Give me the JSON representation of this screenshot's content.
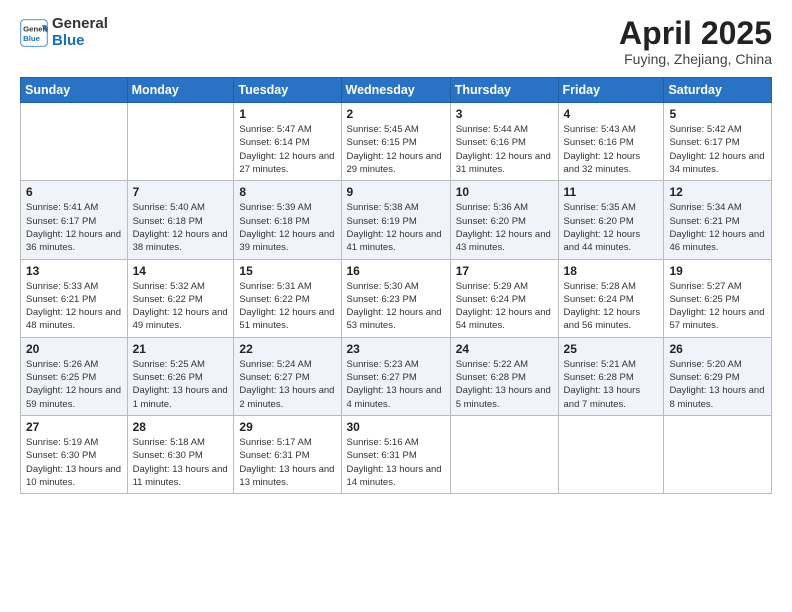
{
  "header": {
    "logo_general": "General",
    "logo_blue": "Blue",
    "month_year": "April 2025",
    "location": "Fuying, Zhejiang, China"
  },
  "weekdays": [
    "Sunday",
    "Monday",
    "Tuesday",
    "Wednesday",
    "Thursday",
    "Friday",
    "Saturday"
  ],
  "weeks": [
    [
      {
        "day": "",
        "info": ""
      },
      {
        "day": "",
        "info": ""
      },
      {
        "day": "1",
        "info": "Sunrise: 5:47 AM\nSunset: 6:14 PM\nDaylight: 12 hours and 27 minutes."
      },
      {
        "day": "2",
        "info": "Sunrise: 5:45 AM\nSunset: 6:15 PM\nDaylight: 12 hours and 29 minutes."
      },
      {
        "day": "3",
        "info": "Sunrise: 5:44 AM\nSunset: 6:16 PM\nDaylight: 12 hours and 31 minutes."
      },
      {
        "day": "4",
        "info": "Sunrise: 5:43 AM\nSunset: 6:16 PM\nDaylight: 12 hours and 32 minutes."
      },
      {
        "day": "5",
        "info": "Sunrise: 5:42 AM\nSunset: 6:17 PM\nDaylight: 12 hours and 34 minutes."
      }
    ],
    [
      {
        "day": "6",
        "info": "Sunrise: 5:41 AM\nSunset: 6:17 PM\nDaylight: 12 hours and 36 minutes."
      },
      {
        "day": "7",
        "info": "Sunrise: 5:40 AM\nSunset: 6:18 PM\nDaylight: 12 hours and 38 minutes."
      },
      {
        "day": "8",
        "info": "Sunrise: 5:39 AM\nSunset: 6:18 PM\nDaylight: 12 hours and 39 minutes."
      },
      {
        "day": "9",
        "info": "Sunrise: 5:38 AM\nSunset: 6:19 PM\nDaylight: 12 hours and 41 minutes."
      },
      {
        "day": "10",
        "info": "Sunrise: 5:36 AM\nSunset: 6:20 PM\nDaylight: 12 hours and 43 minutes."
      },
      {
        "day": "11",
        "info": "Sunrise: 5:35 AM\nSunset: 6:20 PM\nDaylight: 12 hours and 44 minutes."
      },
      {
        "day": "12",
        "info": "Sunrise: 5:34 AM\nSunset: 6:21 PM\nDaylight: 12 hours and 46 minutes."
      }
    ],
    [
      {
        "day": "13",
        "info": "Sunrise: 5:33 AM\nSunset: 6:21 PM\nDaylight: 12 hours and 48 minutes."
      },
      {
        "day": "14",
        "info": "Sunrise: 5:32 AM\nSunset: 6:22 PM\nDaylight: 12 hours and 49 minutes."
      },
      {
        "day": "15",
        "info": "Sunrise: 5:31 AM\nSunset: 6:22 PM\nDaylight: 12 hours and 51 minutes."
      },
      {
        "day": "16",
        "info": "Sunrise: 5:30 AM\nSunset: 6:23 PM\nDaylight: 12 hours and 53 minutes."
      },
      {
        "day": "17",
        "info": "Sunrise: 5:29 AM\nSunset: 6:24 PM\nDaylight: 12 hours and 54 minutes."
      },
      {
        "day": "18",
        "info": "Sunrise: 5:28 AM\nSunset: 6:24 PM\nDaylight: 12 hours and 56 minutes."
      },
      {
        "day": "19",
        "info": "Sunrise: 5:27 AM\nSunset: 6:25 PM\nDaylight: 12 hours and 57 minutes."
      }
    ],
    [
      {
        "day": "20",
        "info": "Sunrise: 5:26 AM\nSunset: 6:25 PM\nDaylight: 12 hours and 59 minutes."
      },
      {
        "day": "21",
        "info": "Sunrise: 5:25 AM\nSunset: 6:26 PM\nDaylight: 13 hours and 1 minute."
      },
      {
        "day": "22",
        "info": "Sunrise: 5:24 AM\nSunset: 6:27 PM\nDaylight: 13 hours and 2 minutes."
      },
      {
        "day": "23",
        "info": "Sunrise: 5:23 AM\nSunset: 6:27 PM\nDaylight: 13 hours and 4 minutes."
      },
      {
        "day": "24",
        "info": "Sunrise: 5:22 AM\nSunset: 6:28 PM\nDaylight: 13 hours and 5 minutes."
      },
      {
        "day": "25",
        "info": "Sunrise: 5:21 AM\nSunset: 6:28 PM\nDaylight: 13 hours and 7 minutes."
      },
      {
        "day": "26",
        "info": "Sunrise: 5:20 AM\nSunset: 6:29 PM\nDaylight: 13 hours and 8 minutes."
      }
    ],
    [
      {
        "day": "27",
        "info": "Sunrise: 5:19 AM\nSunset: 6:30 PM\nDaylight: 13 hours and 10 minutes."
      },
      {
        "day": "28",
        "info": "Sunrise: 5:18 AM\nSunset: 6:30 PM\nDaylight: 13 hours and 11 minutes."
      },
      {
        "day": "29",
        "info": "Sunrise: 5:17 AM\nSunset: 6:31 PM\nDaylight: 13 hours and 13 minutes."
      },
      {
        "day": "30",
        "info": "Sunrise: 5:16 AM\nSunset: 6:31 PM\nDaylight: 13 hours and 14 minutes."
      },
      {
        "day": "",
        "info": ""
      },
      {
        "day": "",
        "info": ""
      },
      {
        "day": "",
        "info": ""
      }
    ]
  ]
}
